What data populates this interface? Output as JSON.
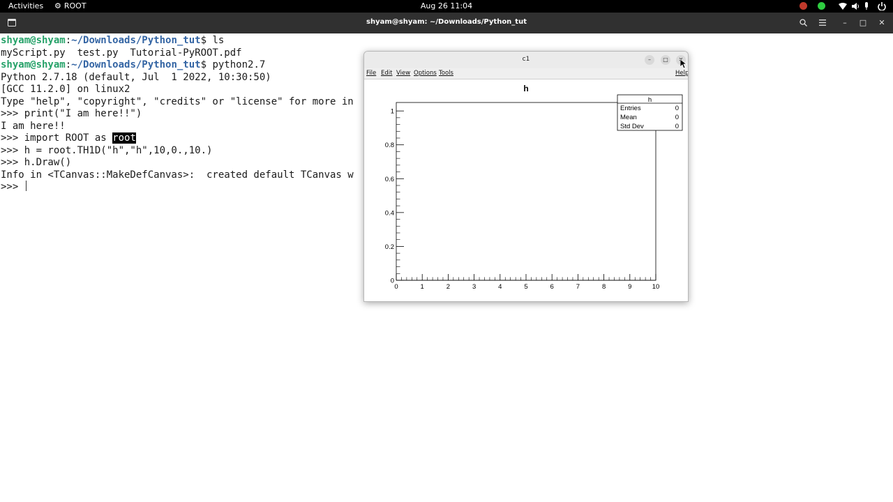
{
  "topbar": {
    "activities": "Activities",
    "app_name": "ROOT",
    "clock": "Aug 26  11:04"
  },
  "terminal": {
    "title": "shyam@shyam: ~/Downloads/Python_tut",
    "lines": [
      {
        "user": "shyam@shyam",
        "sep": ":",
        "path": "~/Downloads/Python_tut",
        "cmd": "$ ls"
      },
      {
        "text": "myScript.py  test.py  Tutorial-PyROOT.pdf"
      },
      {
        "user": "shyam@shyam",
        "sep": ":",
        "path": "~/Downloads/Python_tut",
        "cmd": "$ python2.7"
      },
      {
        "text": "Python 2.7.18 (default, Jul  1 2022, 10:30:50)"
      },
      {
        "text": "[GCC 11.2.0] on linux2"
      },
      {
        "text": "Type \"help\", \"copyright\", \"credits\" or \"license\" for more in"
      },
      {
        "text": ">>> print(\"I am here!!\")"
      },
      {
        "text": "I am here!!"
      },
      {
        "pre": ">>> import ROOT as ",
        "sel": "root"
      },
      {
        "text": ">>> h = root.TH1D(\"h\",\"h\",10,0.,10.)"
      },
      {
        "text": ">>> h.Draw()"
      },
      {
        "text": "Info in <TCanvas::MakeDefCanvas>:  created default TCanvas w"
      },
      {
        "text": ">>> "
      }
    ]
  },
  "canvas": {
    "window_title": "c1",
    "menu": [
      "File",
      "Edit",
      "View",
      "Options",
      "Tools"
    ],
    "help": "Help",
    "stats": {
      "title": "h",
      "rows": [
        {
          "label": "Entries",
          "value": "0"
        },
        {
          "label": "Mean",
          "value": "0"
        },
        {
          "label": "Std Dev",
          "value": "0"
        }
      ]
    }
  },
  "chart_data": {
    "type": "bar",
    "title": "h",
    "xlim": [
      0,
      10
    ],
    "ylim": [
      0,
      1.05
    ],
    "bins": 10,
    "values": [
      0,
      0,
      0,
      0,
      0,
      0,
      0,
      0,
      0,
      0
    ],
    "xticks": [
      0,
      1,
      2,
      3,
      4,
      5,
      6,
      7,
      8,
      9,
      10
    ],
    "xtick_labels": [
      "0",
      "1",
      "2",
      "3",
      "4",
      "5",
      "6",
      "7",
      "8",
      "9",
      "10"
    ],
    "yticks": [
      0,
      0.2,
      0.4,
      0.6,
      0.8,
      1
    ],
    "ytick_labels": [
      "0",
      "0.2",
      "0.4",
      "0.6",
      "0.8",
      "1"
    ],
    "grid": false,
    "legend": "top-right"
  },
  "icons": {
    "app_menu": "gear-icon",
    "terminal_newtab": "new-tab-icon",
    "terminal_search": "search-icon",
    "terminal_menu": "hamburger-icon"
  },
  "colors": {
    "prompt_user": "#26a269",
    "prompt_path": "#3465a4",
    "topbar": "#000000",
    "header": "#303030"
  }
}
